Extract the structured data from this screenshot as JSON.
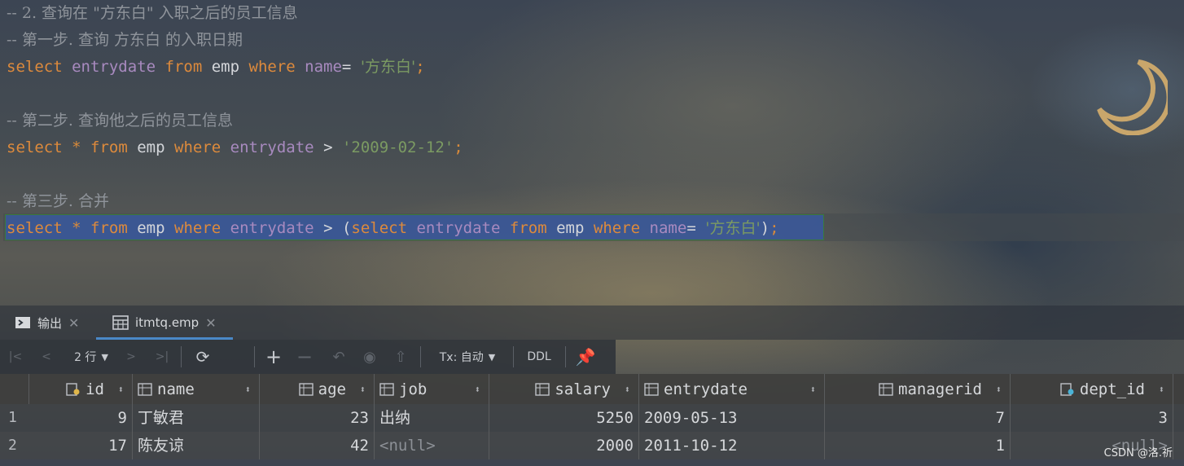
{
  "editor": {
    "lines": [
      {
        "type": "comment",
        "text": "-- 2. 查询在 \"方东白\" 入职之后的员工信息"
      },
      {
        "type": "comment",
        "text": "-- 第一步. 查询 方东白 的入职日期"
      },
      {
        "type": "sql1",
        "kw1": "select",
        "col1": "entrydate",
        "kw2": "from",
        "tbl": "emp",
        "kw3": "where",
        "col2": "name",
        "op": "=",
        "str": "'方东白'",
        "semi": ";"
      },
      {
        "type": "comment",
        "text": "-- 第二步. 查询他之后的员工信息"
      },
      {
        "type": "sql2",
        "kw1": "select",
        "star": "*",
        "kw2": "from",
        "tbl": "emp",
        "kw3": "where",
        "col": "entrydate",
        "op": ">",
        "str": "'2009-02-12'",
        "semi": ";"
      },
      {
        "type": "comment",
        "text": "-- 第三步. 合并"
      },
      {
        "type": "sql3",
        "kw1": "select",
        "star": "*",
        "kw2": "from",
        "tbl": "emp",
        "kw3": "where",
        "col": "entrydate",
        "op": "> (",
        "kw4": "select",
        "col2": "entrydate",
        "kw5": "from",
        "tbl2": "emp",
        "kw6": "where",
        "col3": "name",
        "op2": "=",
        "str": "'方东白'",
        "close": ")",
        "semi": ";"
      }
    ]
  },
  "tabs": [
    {
      "label": "输出",
      "icon": "console-icon"
    },
    {
      "label": "itmtq.emp",
      "icon": "table-icon"
    }
  ],
  "toolbar": {
    "rows_label": "2 行",
    "tx_label": "Tx: 自动",
    "ddl_label": "DDL"
  },
  "table": {
    "columns": [
      {
        "name": "id",
        "icon": "primary-key-icon"
      },
      {
        "name": "name",
        "icon": "column-icon"
      },
      {
        "name": "age",
        "icon": "column-icon"
      },
      {
        "name": "job",
        "icon": "column-icon"
      },
      {
        "name": "salary",
        "icon": "column-icon"
      },
      {
        "name": "entrydate",
        "icon": "column-icon"
      },
      {
        "name": "managerid",
        "icon": "column-icon"
      },
      {
        "name": "dept_id",
        "icon": "foreign-key-icon"
      }
    ],
    "rows": [
      {
        "num": "1",
        "id": "9",
        "name": "丁敏君",
        "age": "23",
        "job": "出纳",
        "salary": "5250",
        "entrydate": "2009-05-13",
        "managerid": "7",
        "dept_id": "3"
      },
      {
        "num": "2",
        "id": "17",
        "name": "陈友谅",
        "age": "42",
        "job": "<null>",
        "salary": "2000",
        "entrydate": "2011-10-12",
        "managerid": "1",
        "dept_id": "<null>"
      }
    ]
  },
  "watermark": "CSDN @洛.祈",
  "colors": {
    "keyword": "#dd8a3c",
    "column": "#a88abf",
    "string": "#7b9a62",
    "comment": "#8f949b",
    "selection": "#38589e"
  }
}
